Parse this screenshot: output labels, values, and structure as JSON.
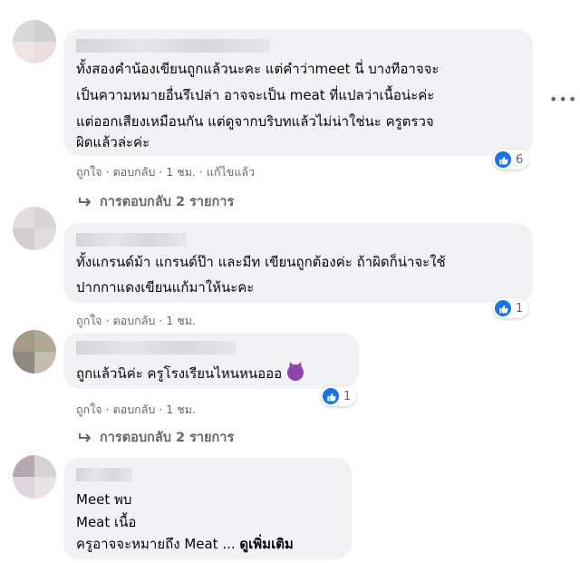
{
  "comments": [
    {
      "lines": [
        "ทั้งสองคำน้องเขียนถูกแล้วนะคะ แต่คำว่าmeet นี่ บางทีอาจจะ",
        "เป็นความหมายอื่นรึเปล่า อาจจะเป็น meat ที่แปลว่าเนื้อน่ะค่ะ",
        "แต่ออกเสียงเหมือนกัน แต่ดูจากบริบทแล้วไม่น่าใช่นะ ครูตรวจ",
        "ผิดแล้วล่ะค่ะ"
      ],
      "actions": {
        "like": "ถูกใจ",
        "reply": "ตอบกลับ",
        "time": "1 ชม.",
        "edited": "แก้ไขแล้ว"
      },
      "reaction_count": "6",
      "replies": "การตอบกลับ 2 รายการ",
      "more_icon": "more-horizontal-icon"
    },
    {
      "lines": [
        "ทั้งแกรนด์ม้า แกรนด์ป๊า และมีท เขียนถูกต้องค่ะ ถ้าผิดก็น่าจะใช้",
        "ปากกาแดงเขียนแก้มาให้นะคะ"
      ],
      "actions": {
        "like": "ถูกใจ",
        "reply": "ตอบกลับ",
        "time": "1 ชม."
      },
      "reaction_count": "1"
    },
    {
      "lines": [
        "ถูกแล้วนิค่ะ ครูโรงเรียนไหนหนอออ"
      ],
      "emoji": "smiling-devil-emoji",
      "actions": {
        "like": "ถูกใจ",
        "reply": "ตอบกลับ",
        "time": "1 ชม."
      },
      "reaction_count": "1",
      "replies": "การตอบกลับ 2 รายการ"
    },
    {
      "lines": [
        "Meet พบ",
        "Meat เนื้อ",
        "ครูอาจจะหมายถึง Meat ..."
      ],
      "see_more": "ดูเพิ่มเติม"
    }
  ],
  "colors": {
    "bubble": "#f0f2f5",
    "like_blue": "#1b74e4",
    "meta_gray": "#65676b"
  }
}
